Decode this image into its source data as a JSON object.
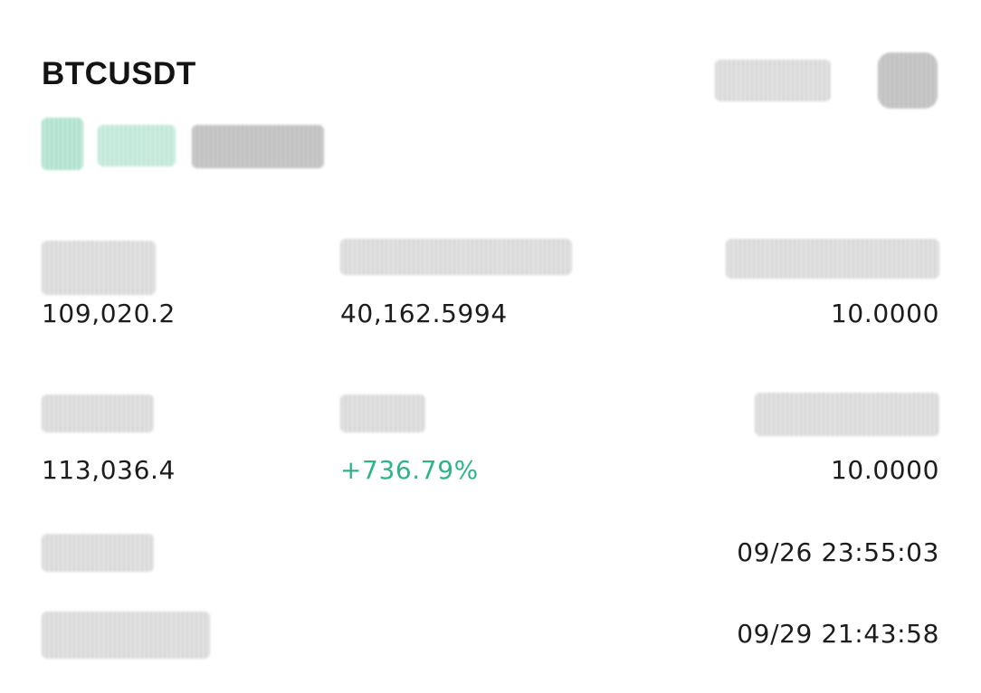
{
  "header": {
    "symbol": "BTCUSDT"
  },
  "stats": {
    "row1": {
      "col1_value": "109,020.2",
      "col2_value": "40,162.5994",
      "col3_value": "10.0000"
    },
    "row2": {
      "col1_value": "113,036.4",
      "col2_value": "+736.79%",
      "col3_value": "10.0000"
    },
    "open_time_value": "09/26 23:55:03",
    "close_time_value": "09/29 21:43:58"
  },
  "colors": {
    "positive": "#2fb48a",
    "text": "#1c1c1c"
  },
  "icons": {
    "top_right": "avatar-icon"
  }
}
